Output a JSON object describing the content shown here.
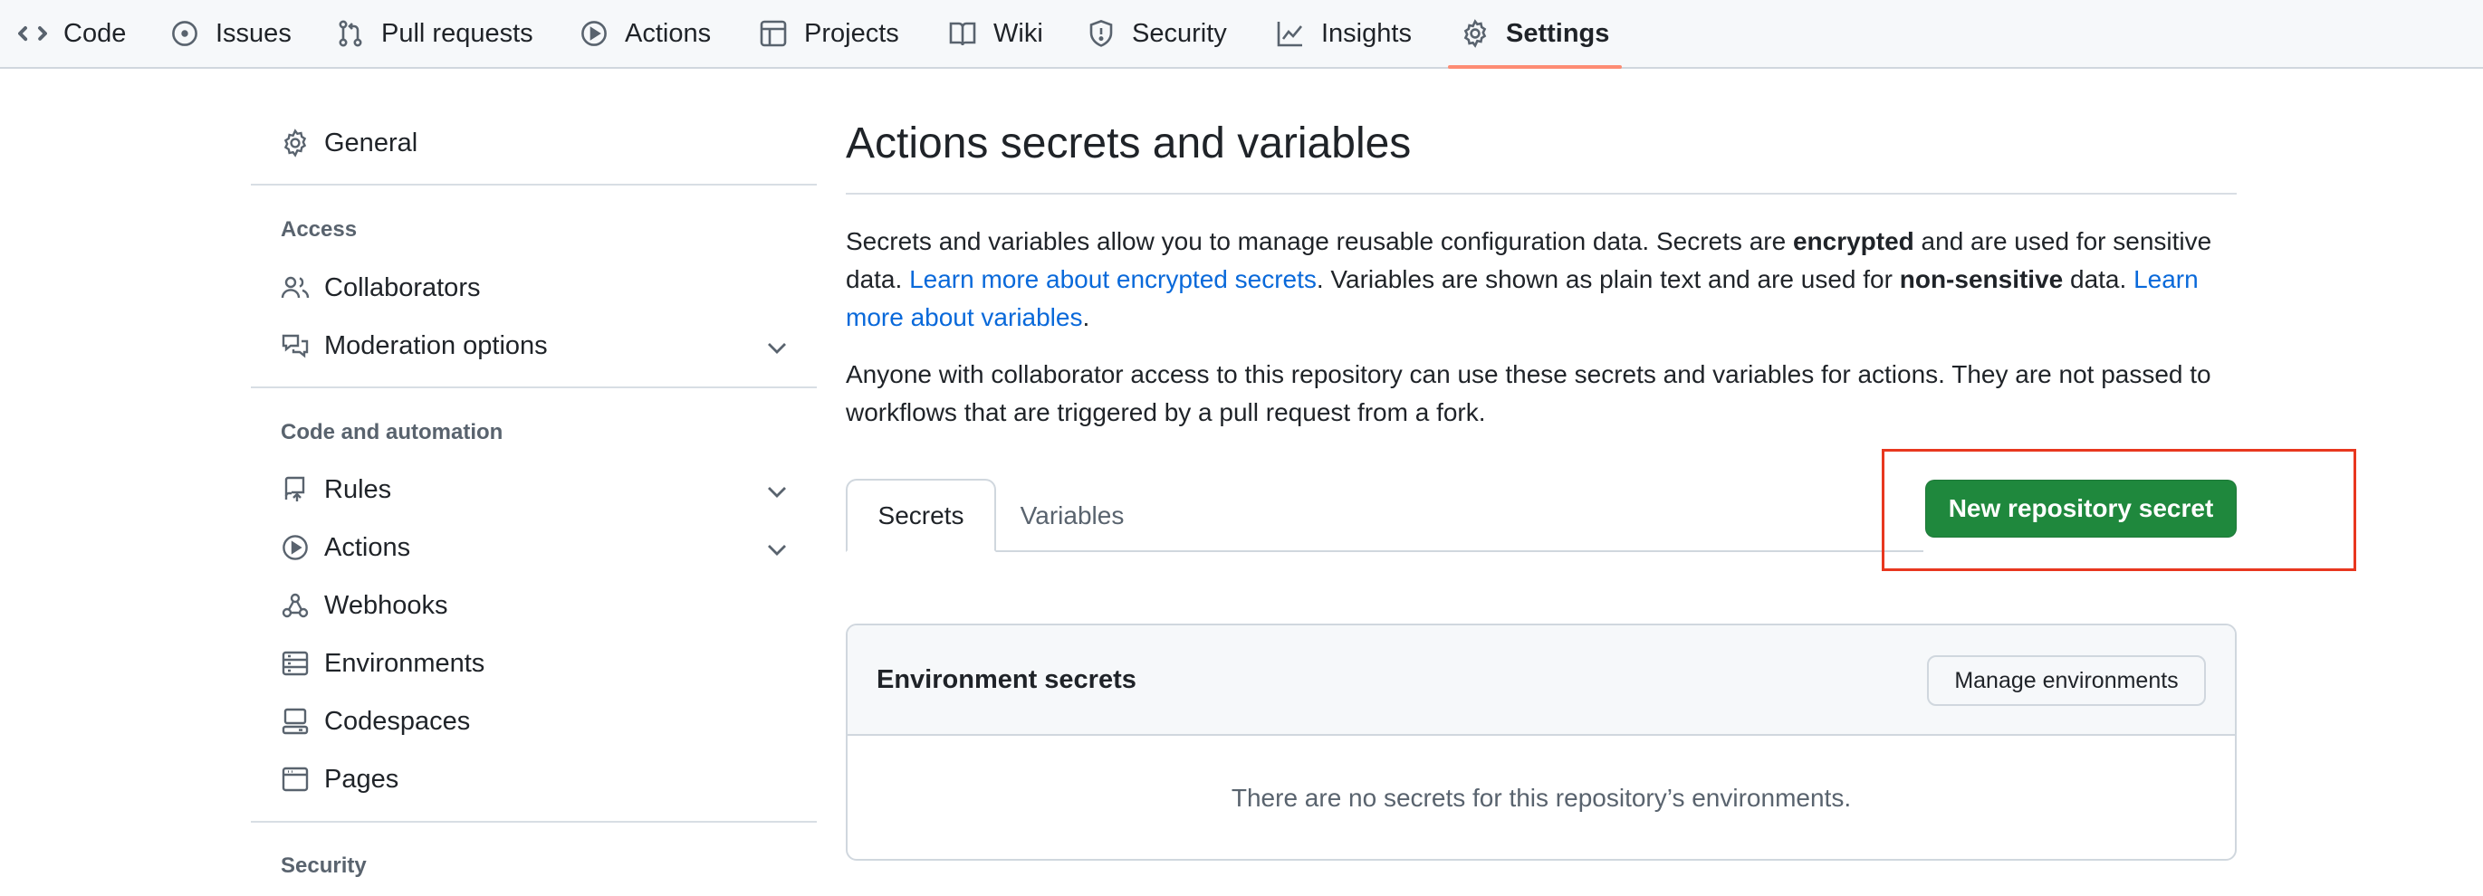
{
  "repo_nav": {
    "tabs": [
      {
        "label": "Code",
        "icon": "code-icon"
      },
      {
        "label": "Issues",
        "icon": "issue-opened-icon"
      },
      {
        "label": "Pull requests",
        "icon": "git-pull-request-icon"
      },
      {
        "label": "Actions",
        "icon": "play-icon"
      },
      {
        "label": "Projects",
        "icon": "table-icon"
      },
      {
        "label": "Wiki",
        "icon": "book-icon"
      },
      {
        "label": "Security",
        "icon": "shield-icon"
      },
      {
        "label": "Insights",
        "icon": "graph-icon"
      },
      {
        "label": "Settings",
        "icon": "gear-icon",
        "active": true
      }
    ]
  },
  "sidebar": {
    "general": "General",
    "access_heading": "Access",
    "collaborators": "Collaborators",
    "moderation": "Moderation options",
    "code_heading": "Code and automation",
    "rules": "Rules",
    "actions": "Actions",
    "webhooks": "Webhooks",
    "environments": "Environments",
    "codespaces": "Codespaces",
    "pages": "Pages",
    "security_heading": "Security"
  },
  "main": {
    "title": "Actions secrets and variables",
    "intro": {
      "t1": "Secrets and variables allow you to manage reusable configuration data. Secrets are ",
      "b1": "encrypted",
      "t2": " and are used for sensitive data. ",
      "link1": "Learn more about encrypted secrets",
      "t3": ". Variables are shown as plain text and are used for ",
      "b2": "non-sensitive",
      "t4": " data. ",
      "link2": "Learn more about variables",
      "t5": "."
    },
    "notice": "Anyone with collaborator access to this repository can use these secrets and variables for actions. They are not passed to workflows that are triggered by a pull request from a fork.",
    "tabs": {
      "secrets": "Secrets",
      "variables": "Variables"
    },
    "new_secret_button": "New repository secret",
    "env_secrets": {
      "title": "Environment secrets",
      "manage_button": "Manage environments",
      "empty": "There are no secrets for this repository’s environments."
    }
  },
  "colors": {
    "primary_button": "#1f883d",
    "link": "#0969da",
    "active_tab_underline": "#fd8c73",
    "highlight_box": "#e8371f"
  }
}
